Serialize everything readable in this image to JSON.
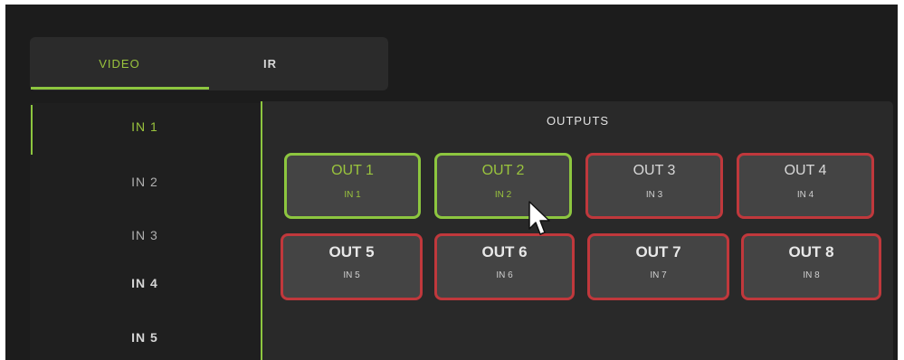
{
  "tabs": [
    {
      "label": "VIDEO",
      "active": true
    },
    {
      "label": "IR",
      "active": false
    }
  ],
  "inputs": [
    {
      "label": "IN 1",
      "state": "active"
    },
    {
      "label": "IN 2",
      "state": "normal"
    },
    {
      "label": "IN 3",
      "state": "normal"
    },
    {
      "label": "IN 4",
      "state": "bold"
    },
    {
      "label": "IN 5",
      "state": "bold"
    }
  ],
  "outputs_title": "OUTPUTS",
  "outputs": [
    {
      "name": "OUT 1",
      "input": "IN 1",
      "routed": true
    },
    {
      "name": "OUT 2",
      "input": "IN 2",
      "routed": true
    },
    {
      "name": "OUT 3",
      "input": "IN 3",
      "routed": false
    },
    {
      "name": "OUT 4",
      "input": "IN 4",
      "routed": false
    },
    {
      "name": "OUT 5",
      "input": "IN 5",
      "routed": false
    },
    {
      "name": "OUT 6",
      "input": "IN 6",
      "routed": false
    },
    {
      "name": "OUT 7",
      "input": "IN 7",
      "routed": false
    },
    {
      "name": "OUT 8",
      "input": "IN 8",
      "routed": false
    }
  ],
  "colors": {
    "accent_green": "#8dc63f",
    "inactive_red": "#c0383c",
    "panel_bg": "#292929",
    "button_bg": "#444444"
  },
  "icons": {
    "cursor": "mouse-pointer-icon"
  }
}
